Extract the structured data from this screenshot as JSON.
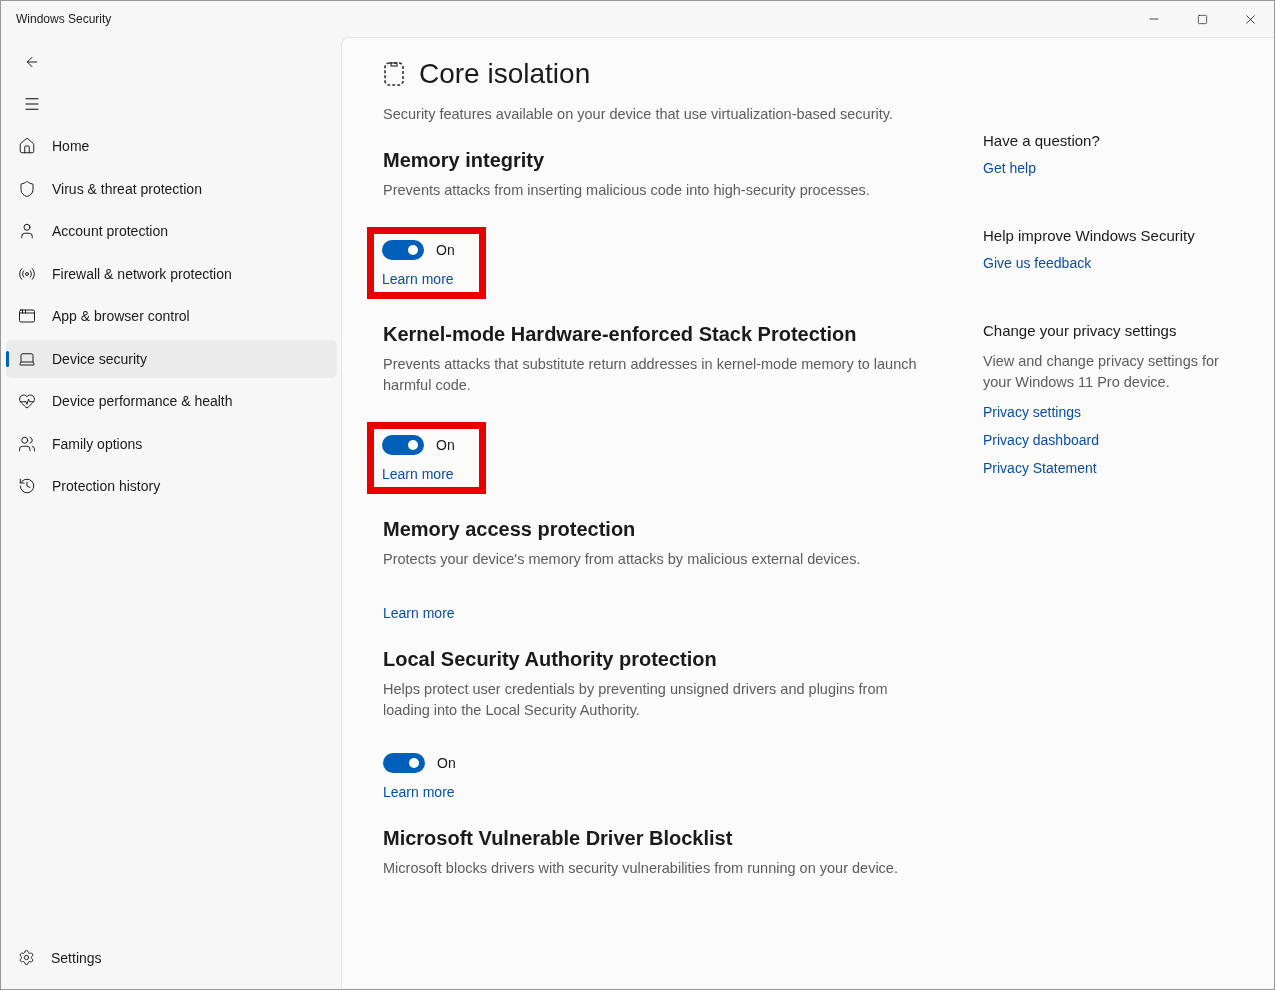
{
  "window": {
    "title": "Windows Security"
  },
  "sidebar": {
    "items": [
      {
        "label": "Home",
        "selected": false
      },
      {
        "label": "Virus & threat protection",
        "selected": false
      },
      {
        "label": "Account protection",
        "selected": false
      },
      {
        "label": "Firewall & network protection",
        "selected": false
      },
      {
        "label": "App & browser control",
        "selected": false
      },
      {
        "label": "Device security",
        "selected": true
      },
      {
        "label": "Device performance & health",
        "selected": false
      },
      {
        "label": "Family options",
        "selected": false
      },
      {
        "label": "Protection history",
        "selected": false
      }
    ],
    "settings": "Settings"
  },
  "page": {
    "title": "Core isolation",
    "description": "Security features available on your device that use virtualization-based security."
  },
  "sections": [
    {
      "kind": "toggle",
      "title": "Memory integrity",
      "description": "Prevents attacks from inserting malicious code into high-security processes.",
      "on": true,
      "state_label": "On",
      "link": "Learn more",
      "highlighted": true
    },
    {
      "kind": "toggle",
      "title": "Kernel-mode Hardware-enforced Stack Protection",
      "description": "Prevents attacks that substitute return addresses in kernel-mode memory to launch harmful code.",
      "on": true,
      "state_label": "On",
      "link": "Learn more",
      "highlighted": true
    },
    {
      "kind": "link",
      "title": "Memory access protection",
      "description": "Protects your device's memory from attacks by malicious external devices.",
      "link": "Learn more",
      "highlighted": false
    },
    {
      "kind": "toggle",
      "title": "Local Security Authority protection",
      "description": "Helps protect user credentials by preventing unsigned drivers and plugins from loading into the Local Security Authority.",
      "on": true,
      "state_label": "On",
      "link": "Learn more",
      "highlighted": false
    },
    {
      "kind": "text",
      "title": "Microsoft Vulnerable Driver Blocklist",
      "description": "Microsoft blocks drivers with security vulnerabilities from running on your device.",
      "highlighted": false
    }
  ],
  "aside": [
    {
      "heading": "Have a question?",
      "links": [
        "Get help"
      ]
    },
    {
      "heading": "Help improve Windows Security",
      "links": [
        "Give us feedback"
      ]
    },
    {
      "heading": "Change your privacy settings",
      "text": "View and change privacy settings for your Windows 11 Pro device.",
      "links": [
        "Privacy settings",
        "Privacy dashboard",
        "Privacy Statement"
      ]
    }
  ]
}
